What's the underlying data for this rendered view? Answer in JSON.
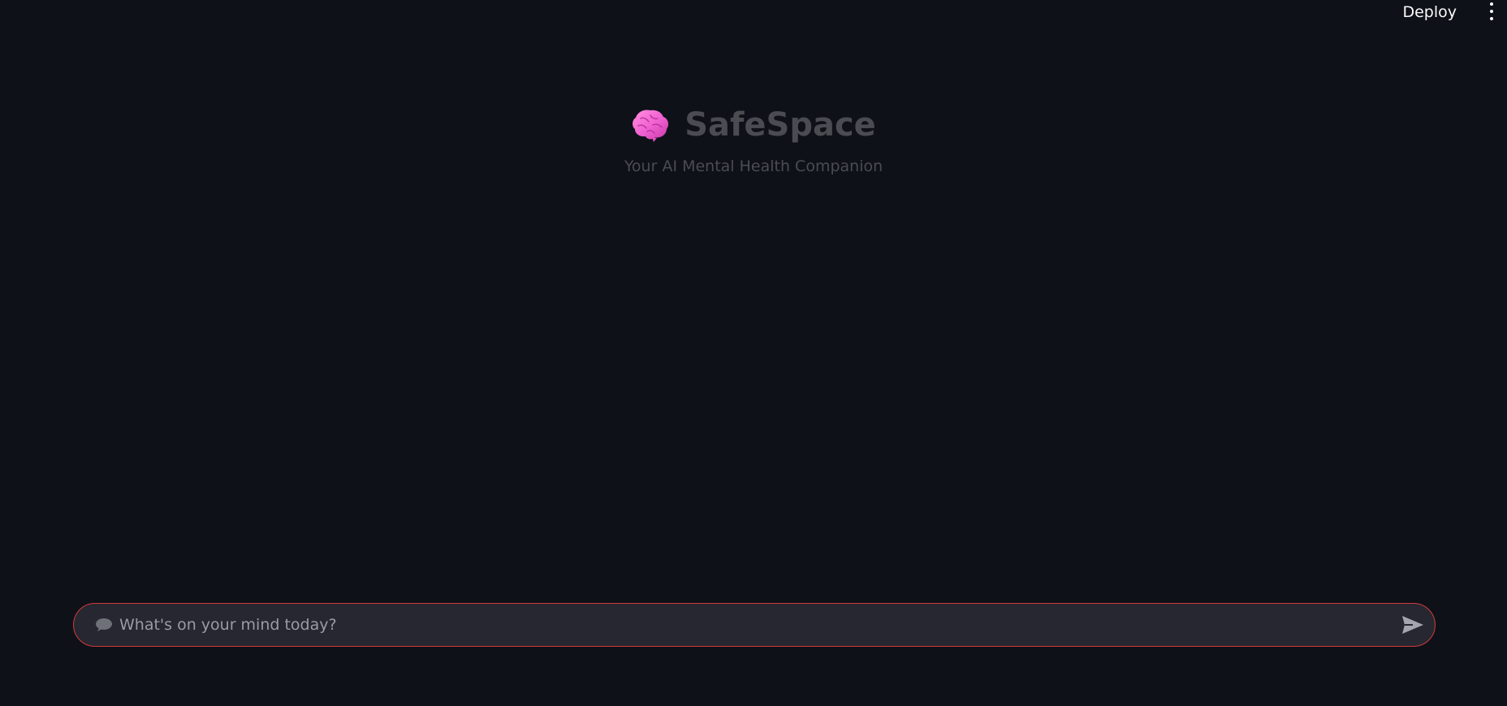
{
  "topbar": {
    "deploy_label": "Deploy",
    "menu_icon": "more-vertical-icon"
  },
  "header": {
    "icon": "brain-icon",
    "title": "SafeSpace",
    "subtitle": "Your AI Mental Health Companion"
  },
  "chat": {
    "input_value": "",
    "placeholder": "What's on your mind today?",
    "leading_icon": "speech-bubble-icon",
    "send_icon": "send-icon"
  },
  "colors": {
    "background": "#0e1118",
    "input_background": "#262730",
    "input_border": "#d13b3b",
    "brain_pink": "#f26ad6",
    "muted_text": "#4a4c52"
  }
}
